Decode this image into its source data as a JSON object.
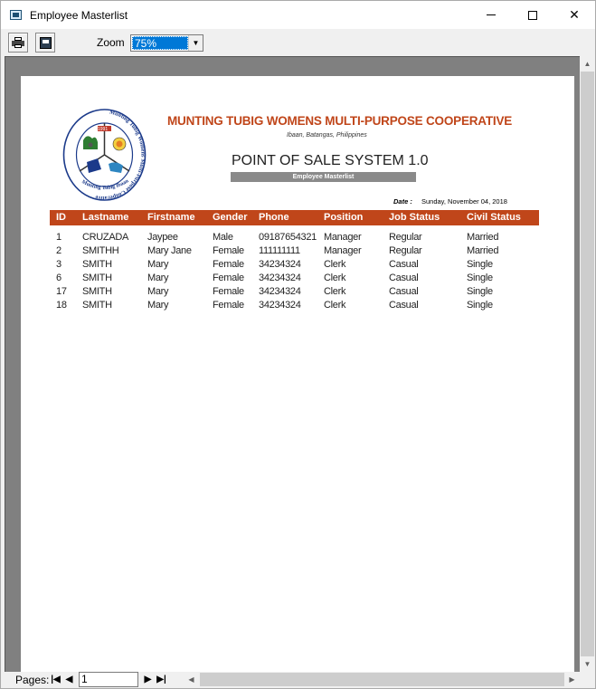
{
  "window": {
    "title": "Employee Masterlist"
  },
  "toolbar": {
    "zoom_label": "Zoom",
    "zoom_value": "75%"
  },
  "report": {
    "org_name": "MUNTING TUBIG WOMENS MULTI-PURPOSE COOPERATIVE",
    "address": "Ibaan, Batangas, Philippines",
    "system_title": "POINT OF SALE SYSTEM 1.0",
    "report_name": "Employee Masterlist",
    "date_label": "Date :",
    "date_value": "Sunday, November 04, 2018",
    "logo": {
      "ring_text": "Munting Tubig Womens Multi-Purpose Cooperative",
      "bottom_text": "Munting Tubig Ibaan Bats.",
      "year": "1991"
    },
    "columns": [
      "ID",
      "Lastname",
      "Firstname",
      "Gender",
      "Phone",
      "Position",
      "Job Status",
      "Civil Status"
    ],
    "rows": [
      [
        "1",
        "CRUZADA",
        "Jaypee",
        "Male",
        "09187654321",
        "Manager",
        "Regular",
        "Married"
      ],
      [
        "2",
        "SMITHH",
        "Mary Jane",
        "Female",
        "111111111",
        "Manager",
        "Regular",
        "Married"
      ],
      [
        "3",
        "SMITH",
        "Mary",
        "Female",
        "34234324",
        "Clerk",
        "Casual",
        "Single"
      ],
      [
        "6",
        "SMITH",
        "Mary",
        "Female",
        "34234324",
        "Clerk",
        "Casual",
        "Single"
      ],
      [
        "17",
        "SMITH",
        "Mary",
        "Female",
        "34234324",
        "Clerk",
        "Casual",
        "Single"
      ],
      [
        "18",
        "SMITH",
        "Mary",
        "Female",
        "34234324",
        "Clerk",
        "Casual",
        "Single"
      ]
    ]
  },
  "bottombar": {
    "pages_label": "Pages:",
    "page_value": "1"
  },
  "colors": {
    "accent": "#c0461a",
    "report_bar": "#8a8a8a",
    "selection": "#0078d7"
  }
}
